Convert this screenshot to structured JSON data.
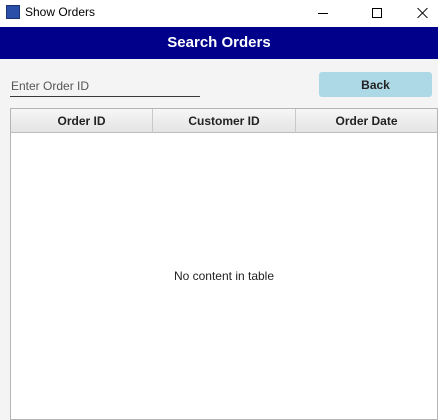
{
  "window": {
    "title": "Show Orders",
    "icon": "java-app-icon",
    "controls": [
      "minimize",
      "maximize",
      "close"
    ]
  },
  "header": {
    "title": "Search Orders",
    "background": "#00008b"
  },
  "search": {
    "placeholder": "Enter Order ID",
    "value": ""
  },
  "back_button": {
    "label": "Back",
    "background": "#add8e6"
  },
  "table": {
    "columns": [
      "Order ID",
      "Customer ID",
      "Order Date"
    ],
    "rows": [],
    "empty_message": "No content in table"
  }
}
